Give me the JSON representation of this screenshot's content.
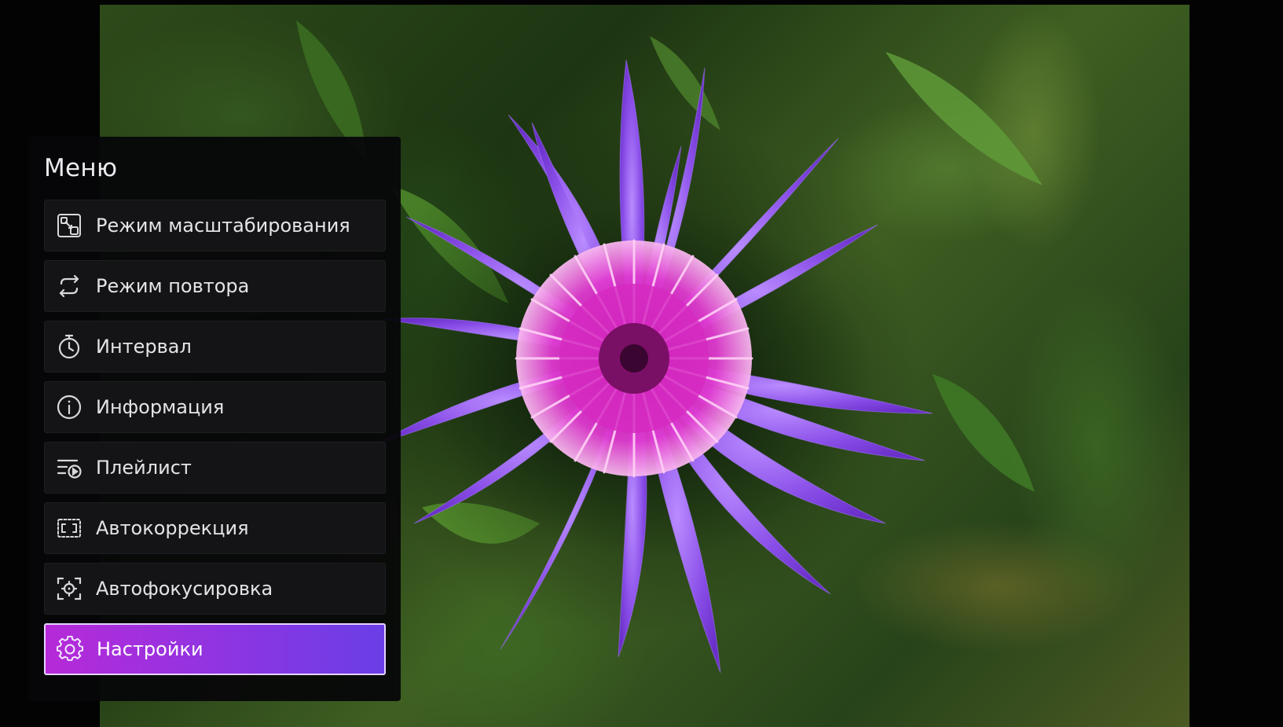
{
  "menu": {
    "title": "Меню",
    "items": [
      {
        "label": "Режим масштабирования",
        "icon": "zoom-mode-icon",
        "active": false
      },
      {
        "label": "Режим повтора",
        "icon": "repeat-icon",
        "active": false
      },
      {
        "label": "Интервал",
        "icon": "timer-icon",
        "active": false
      },
      {
        "label": "Информация",
        "icon": "info-icon",
        "active": false
      },
      {
        "label": "Плейлист",
        "icon": "playlist-icon",
        "active": false
      },
      {
        "label": "Автокоррекция",
        "icon": "auto-correction-icon",
        "active": false
      },
      {
        "label": "Автофокусировка",
        "icon": "auto-focus-icon",
        "active": false
      },
      {
        "label": "Настройки",
        "icon": "settings-icon",
        "active": true
      }
    ]
  },
  "colors": {
    "accent_start": "#b62ad8",
    "accent_end": "#6a3ee6",
    "panel_bg": "#060608",
    "item_bg": "#141417"
  },
  "photo": {
    "subject": "purple-cornflower-photo"
  }
}
